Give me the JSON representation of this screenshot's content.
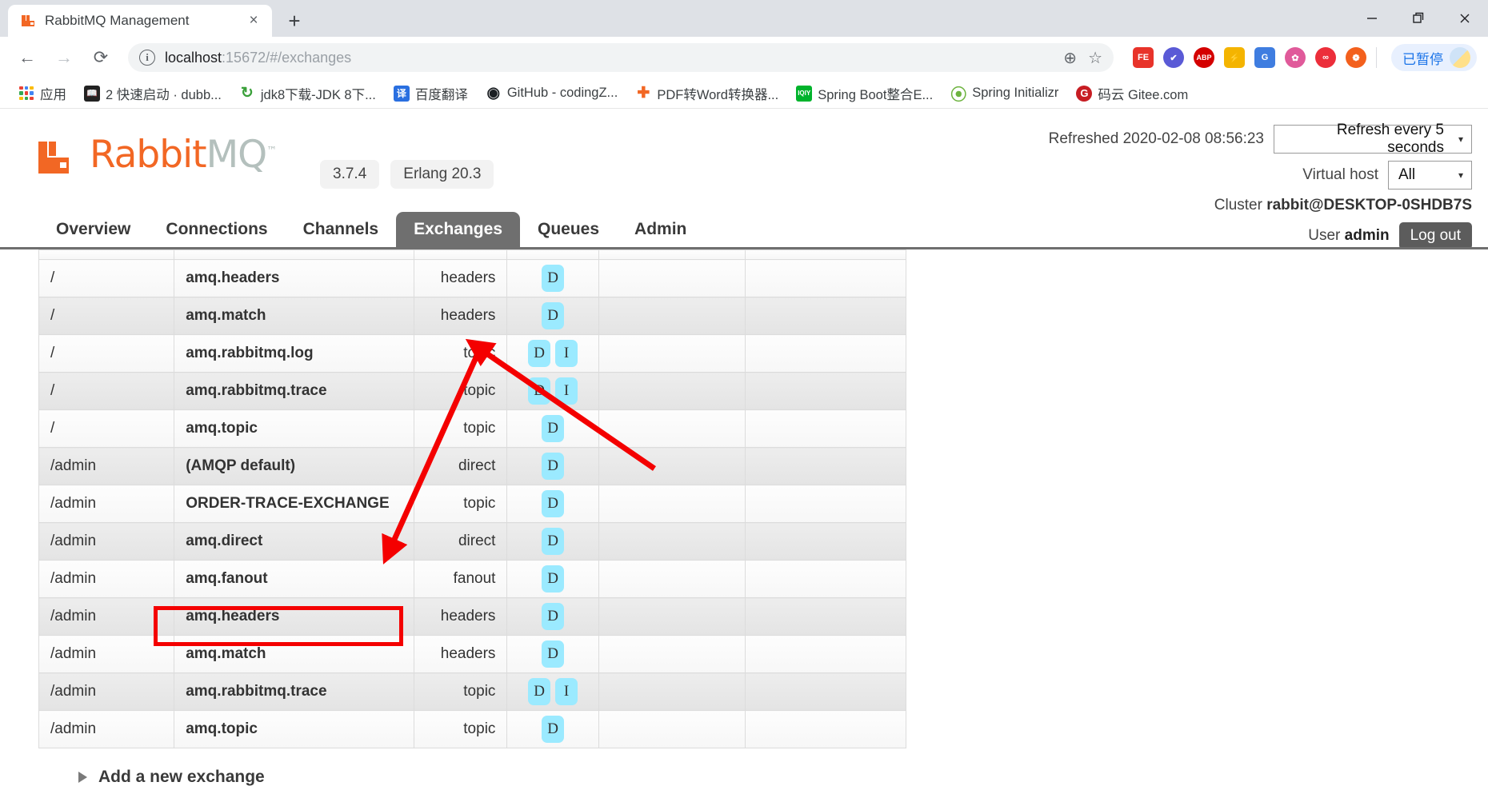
{
  "browser": {
    "tab": {
      "title": "RabbitMQ Management",
      "favicon": "rabbitmq-icon",
      "close": "×"
    },
    "new_tab": "+",
    "window_controls": {
      "minimize": "—",
      "maximize": "❐",
      "close": "✕"
    },
    "nav": {
      "back": "←",
      "forward": "→",
      "reload": "⟳"
    },
    "omnibox": {
      "info_icon": "i",
      "url_host": "localhost",
      "url_rest": ":15672/#/exchanges",
      "zoom_icon": "⊕",
      "bookmark_icon": "☆"
    },
    "extensions": [
      {
        "name": "fe-extension",
        "label": "FE",
        "color": "#e8332a"
      },
      {
        "name": "check-extension",
        "label": "✔",
        "color": "#5a5ad6"
      },
      {
        "name": "adblock-plus-extension",
        "label": "ABP",
        "color": "#d40000"
      },
      {
        "name": "lightning-extension",
        "label": "⚡",
        "color": "#f4b400"
      },
      {
        "name": "google-translate-extension",
        "label": "G",
        "color": "#3f7de0"
      },
      {
        "name": "pinwheel-extension",
        "label": "✿",
        "color": "#e05a9a"
      },
      {
        "name": "infinity-extension",
        "label": "∞",
        "color": "#ec2e3a"
      },
      {
        "name": "life-buoy-extension",
        "label": "❁",
        "color": "#f3601d"
      }
    ],
    "paused": {
      "label": "已暂停",
      "avatar": "weather-avatar"
    },
    "bookmarks": [
      {
        "label": "应用",
        "icon": "apps-grid-icon",
        "color": "#4285f4"
      },
      {
        "label": "2 快速启动 · dubb...",
        "icon": "book-icon",
        "color": "#222222"
      },
      {
        "label": "jdk8下载-JDK 8下...",
        "icon": "refresh-green-icon",
        "color": "#3aa03a"
      },
      {
        "label": "百度翻译",
        "icon": "baidu-translate-icon",
        "color": "#2a6fe0"
      },
      {
        "label": "GitHub - codingZ...",
        "icon": "github-icon",
        "color": "#1b1f23"
      },
      {
        "label": "PDF转Word转换器...",
        "icon": "pdf-icon",
        "color": "#f26724"
      },
      {
        "label": "Spring Boot整合E...",
        "icon": "iqiyi-icon",
        "color": "#00b32c"
      },
      {
        "label": "Spring Initializr",
        "icon": "spring-leaf-icon",
        "color": "#6db33f"
      },
      {
        "label": "码云 Gitee.com",
        "icon": "gitee-icon",
        "color": "#c71d23"
      }
    ]
  },
  "app": {
    "logo": {
      "rabbit": "Rabbit",
      "mq": "MQ",
      "tm": "™"
    },
    "versions": {
      "server": "3.7.4",
      "erlang": "Erlang 20.3"
    },
    "header": {
      "refreshed_label": "Refreshed 2020-02-08 08:56:23",
      "refresh_select": "Refresh every 5 seconds",
      "vhost_label": "Virtual host",
      "vhost_select": "All",
      "cluster_label": "Cluster",
      "cluster_name": "rabbit@DESKTOP-0SHDB7S",
      "user_label": "User",
      "user_name": "admin",
      "logout": "Log out",
      "caret": "▾"
    },
    "tabs": [
      {
        "label": "Overview",
        "active": false
      },
      {
        "label": "Connections",
        "active": false
      },
      {
        "label": "Channels",
        "active": false
      },
      {
        "label": "Exchanges",
        "active": true
      },
      {
        "label": "Queues",
        "active": false
      },
      {
        "label": "Admin",
        "active": false
      }
    ],
    "table": {
      "rows": [
        {
          "vhost": "/",
          "name": "amq.headers",
          "type": "headers",
          "features": [
            "D"
          ]
        },
        {
          "vhost": "/",
          "name": "amq.match",
          "type": "headers",
          "features": [
            "D"
          ]
        },
        {
          "vhost": "/",
          "name": "amq.rabbitmq.log",
          "type": "topic",
          "features": [
            "D",
            "I"
          ]
        },
        {
          "vhost": "/",
          "name": "amq.rabbitmq.trace",
          "type": "topic",
          "features": [
            "D",
            "I"
          ]
        },
        {
          "vhost": "/",
          "name": "amq.topic",
          "type": "topic",
          "features": [
            "D"
          ]
        },
        {
          "vhost": "/admin",
          "name": "(AMQP default)",
          "type": "direct",
          "features": [
            "D"
          ]
        },
        {
          "vhost": "/admin",
          "name": "ORDER-TRACE-EXCHANGE",
          "type": "topic",
          "features": [
            "D"
          ],
          "highlighted": true
        },
        {
          "vhost": "/admin",
          "name": "amq.direct",
          "type": "direct",
          "features": [
            "D"
          ]
        },
        {
          "vhost": "/admin",
          "name": "amq.fanout",
          "type": "fanout",
          "features": [
            "D"
          ]
        },
        {
          "vhost": "/admin",
          "name": "amq.headers",
          "type": "headers",
          "features": [
            "D"
          ]
        },
        {
          "vhost": "/admin",
          "name": "amq.match",
          "type": "headers",
          "features": [
            "D"
          ]
        },
        {
          "vhost": "/admin",
          "name": "amq.rabbitmq.trace",
          "type": "topic",
          "features": [
            "D",
            "I"
          ]
        },
        {
          "vhost": "/admin",
          "name": "amq.topic",
          "type": "topic",
          "features": [
            "D"
          ]
        }
      ]
    },
    "add_new_exchange": "Add a new exchange"
  },
  "annotations": {
    "highlight_color": "#f40000",
    "arrow_color": "#f40000",
    "arrow_count": 2
  }
}
